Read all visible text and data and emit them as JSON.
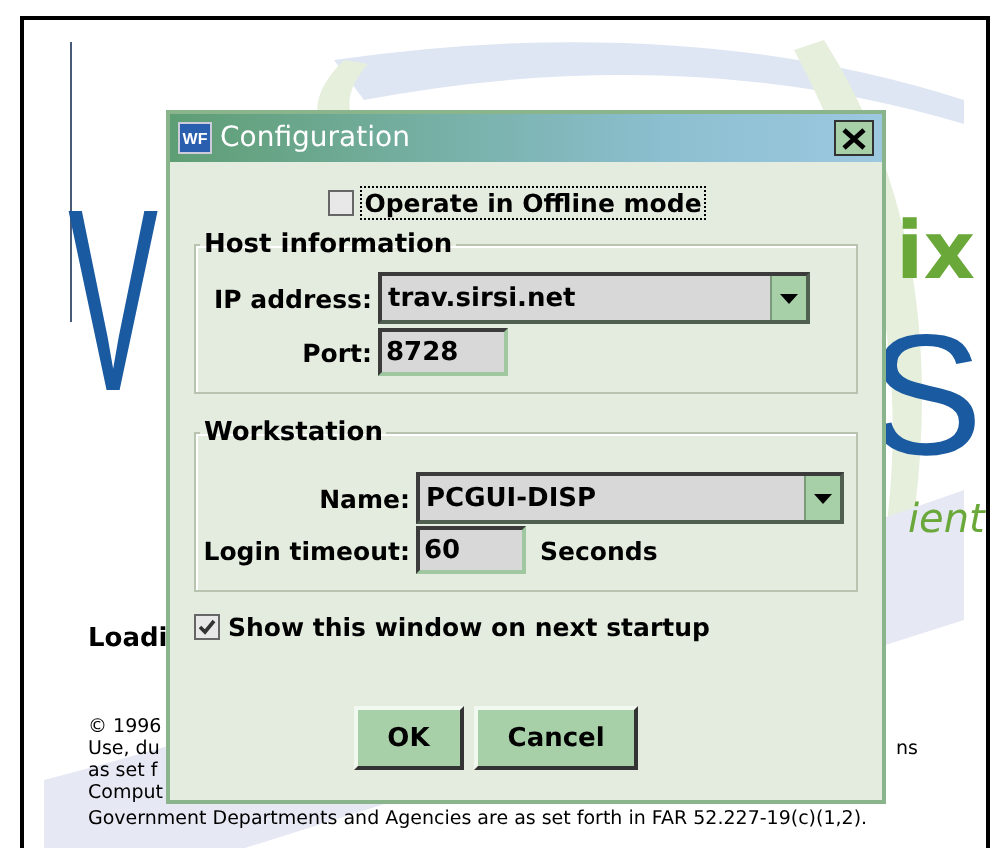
{
  "splash": {
    "logo": {
      "left_letter": "V",
      "right_top": "ix",
      "right_letter": "S",
      "tagline": "ient"
    },
    "loading": "Loadi",
    "legal_left": [
      "© 1996",
      "Use, du",
      "as set f",
      "Comput"
    ],
    "legal_right": "ns",
    "legal_full": "Government Departments and Agencies are as set forth in FAR 52.227-19(c)(1,2)."
  },
  "window": {
    "title": "Configuration",
    "app_icon": "WF"
  },
  "offline": {
    "label": "Operate in Offline mode",
    "checked": false
  },
  "host": {
    "legend": "Host information",
    "ip": {
      "label": "IP address:",
      "value": "trav.sirsi.net"
    },
    "port": {
      "label": "Port:",
      "value": "8728"
    }
  },
  "workstation": {
    "legend": "Workstation",
    "name": {
      "label": "Name:",
      "value": "PCGUI-DISP"
    },
    "timeout": {
      "label": "Login timeout:",
      "value": "60",
      "unit": "Seconds"
    }
  },
  "show_on_startup": {
    "label": "Show this window on next startup",
    "checked": true
  },
  "buttons": [
    "OK",
    "Cancel"
  ]
}
